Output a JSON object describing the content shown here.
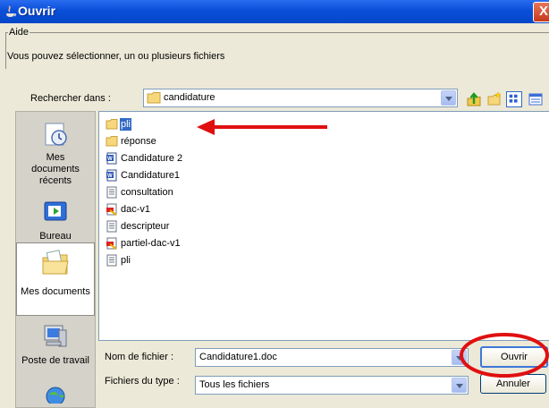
{
  "window": {
    "title": "Ouvrir",
    "close_label": "X"
  },
  "help": {
    "legend": "Aide",
    "text": "Vous pouvez sélectionner, un ou plusieurs fichiers"
  },
  "lookin": {
    "label": "Rechercher dans :",
    "value": "candidature"
  },
  "places": [
    {
      "label": "Mes documents récents",
      "icon": "recent-icon"
    },
    {
      "label": "Bureau",
      "icon": "desktop-icon"
    },
    {
      "label": "Mes documents",
      "icon": "my-documents-icon"
    },
    {
      "label": "Poste de travail",
      "icon": "computer-icon"
    }
  ],
  "files": [
    {
      "name": "pli",
      "type": "folder",
      "selected": true
    },
    {
      "name": "réponse",
      "type": "folder"
    },
    {
      "name": "Candidature 2",
      "type": "word"
    },
    {
      "name": "Candidature1",
      "type": "word"
    },
    {
      "name": "consultation",
      "type": "text"
    },
    {
      "name": "dac-v1",
      "type": "pdf"
    },
    {
      "name": "descripteur",
      "type": "text"
    },
    {
      "name": "partiel-dac-v1",
      "type": "pdf"
    },
    {
      "name": "pli",
      "type": "text"
    }
  ],
  "filename": {
    "label": "Nom de fichier :",
    "value": "Candidature1.doc"
  },
  "filetype": {
    "label": "Fichiers du type :",
    "value": "Tous les fichiers"
  },
  "buttons": {
    "open": "Ouvrir",
    "cancel": "Annuler"
  },
  "annotation": {
    "arrow_color": "#e01010",
    "circle_color": "#e01010"
  }
}
